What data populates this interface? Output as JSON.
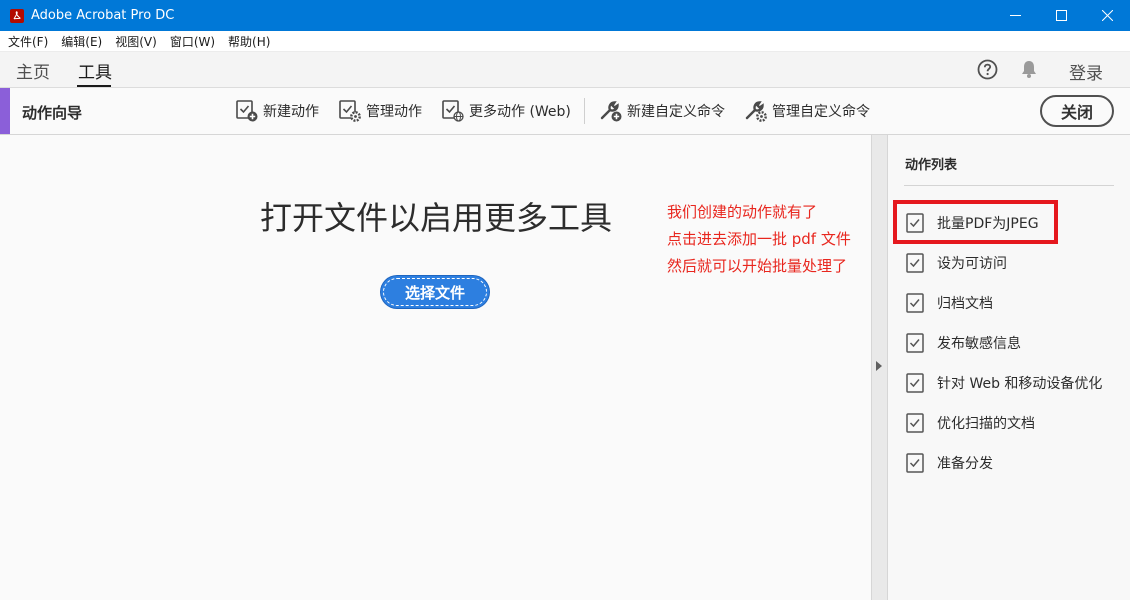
{
  "window": {
    "title": "Adobe Acrobat Pro DC"
  },
  "menu": [
    "文件(F)",
    "编辑(E)",
    "视图(V)",
    "窗口(W)",
    "帮助(H)"
  ],
  "nav": {
    "home": "主页",
    "tools": "工具",
    "login": "登录"
  },
  "toolbar": {
    "title": "动作向导",
    "new_action": "新建动作",
    "manage_actions": "管理动作",
    "more_actions": "更多动作 (Web)",
    "new_custom_command": "新建自定义命令",
    "manage_custom_commands": "管理自定义命令",
    "close": "关闭"
  },
  "main": {
    "heading": "打开文件以启用更多工具",
    "select_file": "选择文件",
    "annotation": [
      "我们创建的动作就有了",
      "点击进去添加一批 pdf 文件",
      "然后就可以开始批量处理了"
    ]
  },
  "panel": {
    "title": "动作列表",
    "items": [
      "批量PDF为JPEG",
      "设为可访问",
      "归档文档",
      "发布敏感信息",
      "针对 Web 和移动设备优化",
      "优化扫描的文档",
      "准备分发"
    ]
  },
  "colors": {
    "titlebar": "#0078d7",
    "accent": "#8b5fd9",
    "primary_button": "#2d7fe0",
    "annotation": "#e8261e",
    "highlight": "#e5181e"
  }
}
